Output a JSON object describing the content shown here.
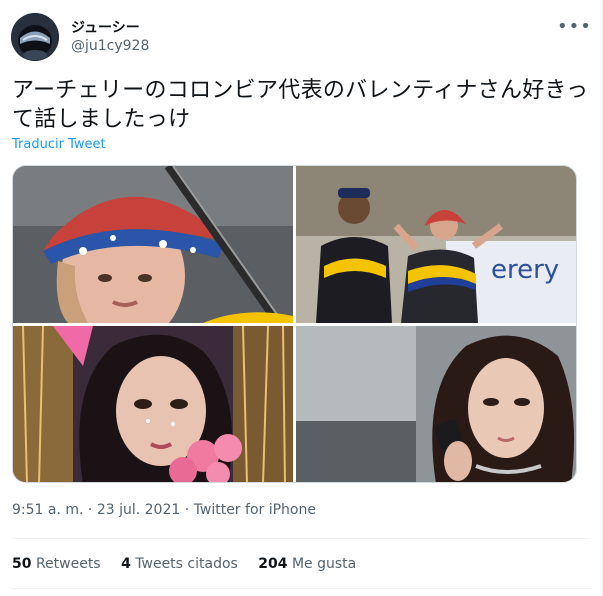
{
  "user": {
    "display_name": "ジューシー",
    "handle": "@ju1cy928",
    "avatar_icon": "helmet-avatar-icon"
  },
  "tweet": {
    "text": "アーチェリーのコロンビア代表のバレンティナさん好きって話しましたっけ",
    "translate_label": "Traducir Tweet",
    "time": "9:51 a. m.",
    "separator": "·",
    "date": "23 jul. 2021",
    "source": "Twitter for iPhone"
  },
  "photo_text": {
    "banner_fragment": "erery"
  },
  "stats": {
    "retweets_count": "50",
    "retweets_label": "Retweets",
    "quotes_count": "4",
    "quotes_label": "Tweets citados",
    "likes_count": "204",
    "likes_label": "Me gusta"
  },
  "colors": {
    "link": "#1d9bf0",
    "secondary_text": "#536471",
    "border": "#cfd9de",
    "colombia_yellow": "#f5c400",
    "colombia_blue": "#1f3f99",
    "colombia_red": "#d6202a"
  }
}
